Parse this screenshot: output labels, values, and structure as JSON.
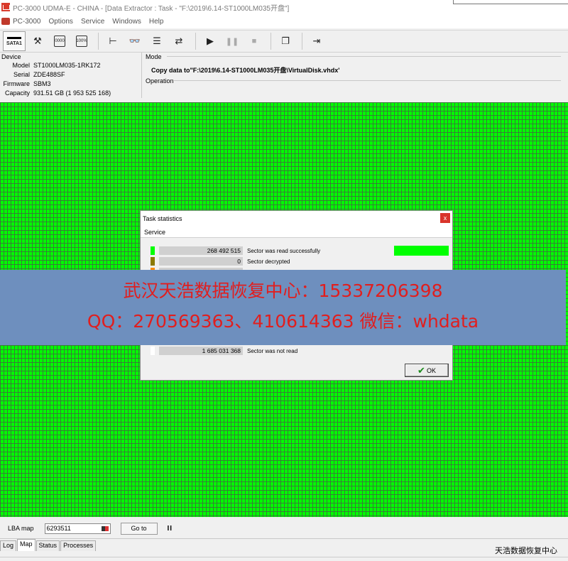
{
  "window": {
    "title": "PC-3000 UDMA-E - CHINA - [Data Extractor : Task - \"F:\\2019\\6.14-ST1000LM035开盘\"]"
  },
  "menu": {
    "app_label": "PC-3000",
    "items": [
      "Options",
      "Service",
      "Windows",
      "Help"
    ]
  },
  "toolbar": {
    "sata_label": "SATA1",
    "box_icon_1": "0000",
    "box_icon_2": "100%"
  },
  "device": {
    "caption": "Device",
    "fields": [
      {
        "key": "Model",
        "value": "ST1000LM035-1RK172"
      },
      {
        "key": "Serial",
        "value": "ZDE488SF"
      },
      {
        "key": "Firmware",
        "value": "SBM3"
      },
      {
        "key": "Capacity",
        "value": "931.51 GB (1 953 525 168)"
      }
    ]
  },
  "mode": {
    "caption": "Mode",
    "text": "Copy data to\"F:\\2019\\6.14-ST1000LM035开盘\\VirtualDisk.vhdx'"
  },
  "operation": {
    "caption": "Operation"
  },
  "dialog": {
    "title": "Task statistics",
    "close_label": "x",
    "service_label": "Service",
    "rows": [
      {
        "count": "268 492 515",
        "label": "Sector was read successfully",
        "color": "#00ff00"
      },
      {
        "count": "0",
        "label": "Sector decrypted",
        "color": "#8b7a00"
      },
      {
        "count": "",
        "label": "",
        "color": "#ff8c00"
      },
      {
        "count": "1 685 031 368",
        "label": "Sector was not read",
        "color": "#ffffff"
      }
    ],
    "ok_label": "OK"
  },
  "banner": {
    "line1": "武汉天浩数据恢复中心：15337206398",
    "line2": "QQ：270569363、410614363   微信：whdata"
  },
  "lba": {
    "label": "LBA map",
    "value": "6293511",
    "goto_label": "Go to",
    "pause_label": "II"
  },
  "tabs": [
    "Log",
    "Map",
    "Status",
    "Processes"
  ],
  "watermark": "天浩数据恢复中心"
}
